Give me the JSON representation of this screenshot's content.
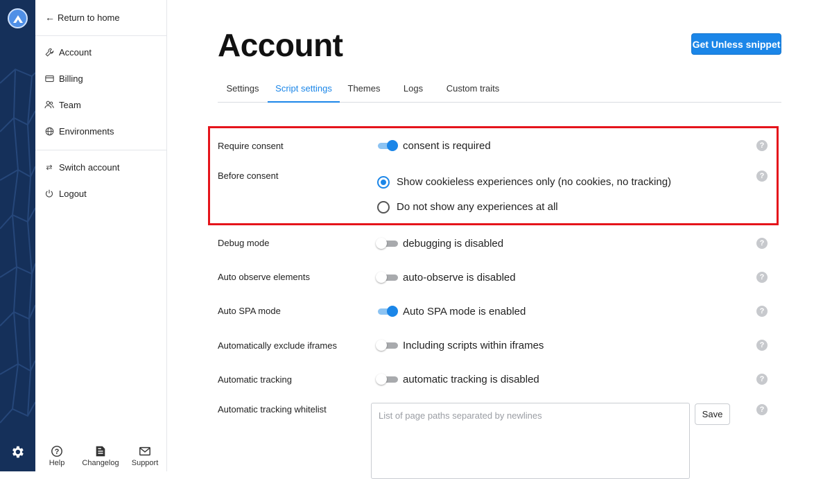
{
  "sidebar": {
    "return_label": "Return to home",
    "nav_items": [
      {
        "label": "Account",
        "icon": "wrench-icon"
      },
      {
        "label": "Billing",
        "icon": "credit-card-icon"
      },
      {
        "label": "Team",
        "icon": "team-icon"
      },
      {
        "label": "Environments",
        "icon": "globe-icon"
      }
    ],
    "account_items": [
      {
        "label": "Switch account",
        "icon": "switch-icon"
      },
      {
        "label": "Logout",
        "icon": "power-icon"
      }
    ],
    "footer": [
      {
        "label": "Help",
        "icon": "help-icon"
      },
      {
        "label": "Changelog",
        "icon": "changelog-icon"
      },
      {
        "label": "Support",
        "icon": "mail-icon"
      }
    ]
  },
  "header": {
    "title": "Account",
    "snippet_button": "Get Unless snippet"
  },
  "tabs": [
    {
      "label": "Settings",
      "active": false
    },
    {
      "label": "Script settings",
      "active": true
    },
    {
      "label": "Themes",
      "active": false
    },
    {
      "label": "Logs",
      "active": false
    },
    {
      "label": "Custom traits",
      "active": false
    }
  ],
  "settings": {
    "require_consent": {
      "label": "Require consent",
      "value": "consent is required",
      "enabled": true
    },
    "before_consent": {
      "label": "Before consent",
      "options": [
        {
          "label": "Show cookieless experiences only (no cookies, no tracking)",
          "checked": true
        },
        {
          "label": "Do not show any experiences at all",
          "checked": false
        }
      ]
    },
    "debug_mode": {
      "label": "Debug mode",
      "value": "debugging is disabled",
      "enabled": false
    },
    "auto_observe": {
      "label": "Auto observe elements",
      "value": "auto-observe is disabled",
      "enabled": false
    },
    "auto_spa": {
      "label": "Auto SPA mode",
      "value": "Auto SPA mode is enabled",
      "enabled": true
    },
    "exclude_iframes": {
      "label": "Automatically exclude iframes",
      "value": "Including scripts within iframes",
      "enabled": false
    },
    "auto_tracking": {
      "label": "Automatic tracking",
      "value": "automatic tracking is disabled",
      "enabled": false
    },
    "tracking_whitelist": {
      "label": "Automatic tracking whitelist",
      "placeholder": "List of page paths separated by newlines",
      "save_label": "Save"
    }
  },
  "colors": {
    "accent": "#1b86e8",
    "rail": "#15305a",
    "highlight": "#e5141b"
  },
  "help_glyph": "?"
}
